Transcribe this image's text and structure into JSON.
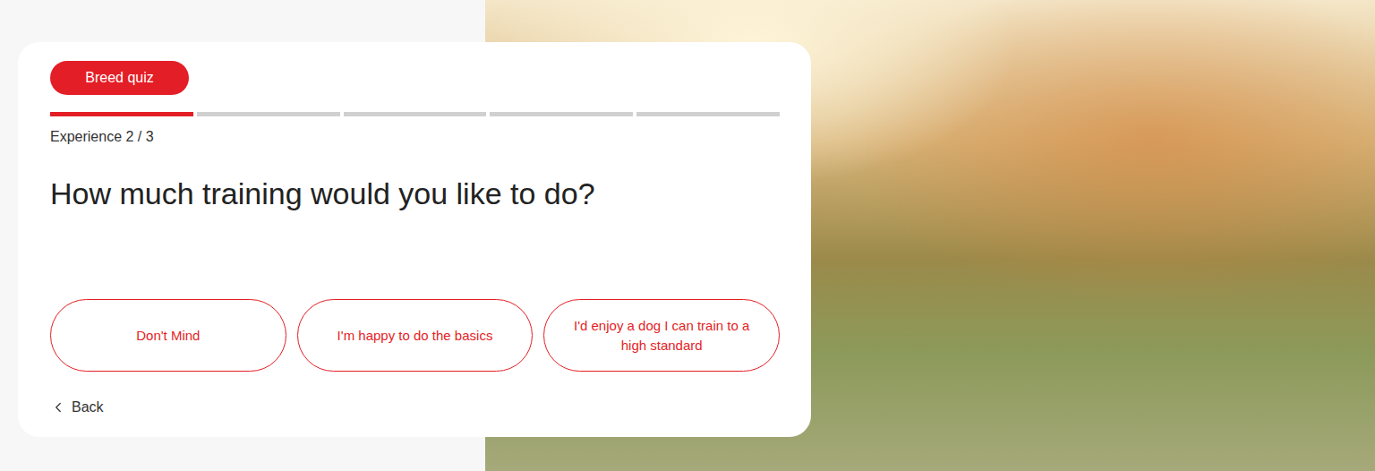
{
  "badge": "Breed quiz",
  "progress": [
    {
      "filled": true
    },
    {
      "filled": false
    },
    {
      "filled": false
    },
    {
      "filled": false
    },
    {
      "filled": false
    }
  ],
  "step": "Experience 2 / 3",
  "question": "How much training would you like to do?",
  "options": [
    {
      "label": "Don't Mind",
      "selected": false
    },
    {
      "label": "I'm happy to do the basics",
      "selected": false
    },
    {
      "label": "I'd enjoy a dog I can train to a high standard",
      "selected": false
    }
  ],
  "back": {
    "label": "Back"
  }
}
